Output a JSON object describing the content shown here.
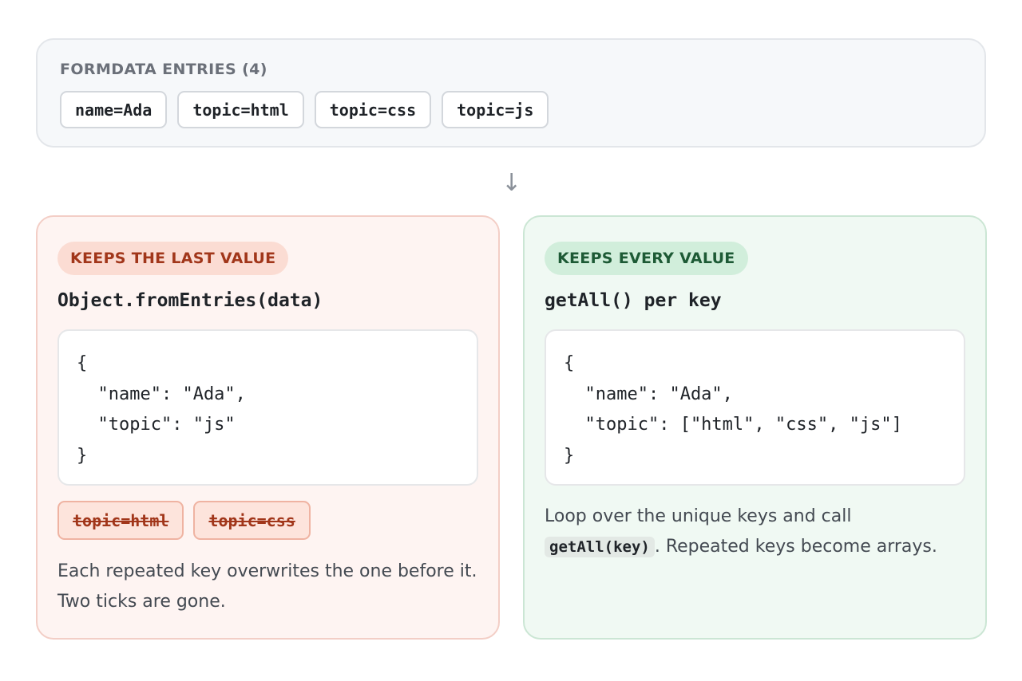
{
  "entries": {
    "title": "FORMDATA ENTRIES (4)",
    "items": [
      "name=Ada",
      "topic=html",
      "topic=css",
      "topic=js"
    ]
  },
  "arrow": "↓",
  "left": {
    "badge": "KEEPS THE LAST VALUE",
    "method": "Object.fromEntries(data)",
    "code": "{\n  \"name\": \"Ada\",\n  \"topic\": \"js\"\n}",
    "struck": [
      "topic=html",
      "topic=css"
    ],
    "caption_line1": "Each repeated key overwrites the one before it.",
    "caption_line2": "Two ticks are gone."
  },
  "right": {
    "badge": "KEEPS EVERY VALUE",
    "method": "getAll() per key",
    "code": "{\n  \"name\": \"Ada\",\n  \"topic\": [\"html\", \"css\", \"js\"]\n}",
    "caption_pre": "Loop over the unique keys and call",
    "caption_code": "getAll(key)",
    "caption_post": ". Repeated keys become arrays."
  },
  "colors": {
    "left_accent": "#a1361a",
    "right_accent": "#1d5a35"
  }
}
